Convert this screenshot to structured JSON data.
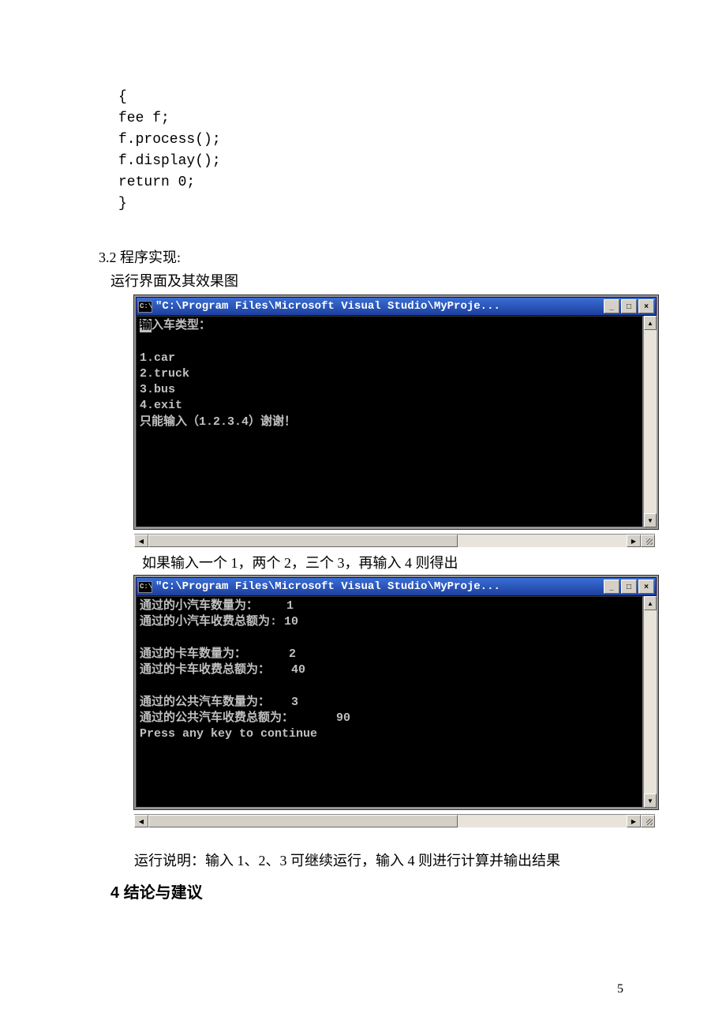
{
  "code": {
    "l1": "{",
    "l2": "fee f;",
    "l3": "f.process();",
    "l4": "f.display();",
    "l5": "return 0;",
    "l6": "}"
  },
  "section_32": "3.2 程序实现:",
  "section_32_sub": "运行界面及其效果图",
  "window_title": "\"C:\\Program Files\\Microsoft Visual Studio\\MyProje...",
  "title_icon": "C:\\",
  "win_min": "_",
  "win_max": "□",
  "win_close": "×",
  "scroll_up": "▲",
  "scroll_down": "▼",
  "scroll_left": "◀",
  "scroll_right": "▶",
  "console1": {
    "line1_a": "输",
    "line1_b": "入车类型：",
    "l2": "",
    "l3": "1.car",
    "l4": "2.truck",
    "l5": "3.bus",
    "l6": "4.exit",
    "l7": "只能输入（1.2.3.4）谢谢！"
  },
  "midtext": "如果输入一个 1，两个 2，三个 3，再输入 4 则得出",
  "console2": {
    "l1": "通过的小汽车数量为：    1",
    "l2": "通过的小汽车收费总额为: 10",
    "l3": "",
    "l4": "通过的卡车数量为：      2",
    "l5": "通过的卡车收费总额为：   40",
    "l6": "",
    "l7": "通过的公共汽车数量为：   3",
    "l8": "通过的公共汽车收费总额为：      90",
    "l9": "Press any key to continue"
  },
  "note": "运行说明：输入 1、2、3 可继续运行，输入 4 则进行计算并输出结果",
  "h4_num": "4",
  "h4_text": "结论与建议",
  "page_number": "5"
}
